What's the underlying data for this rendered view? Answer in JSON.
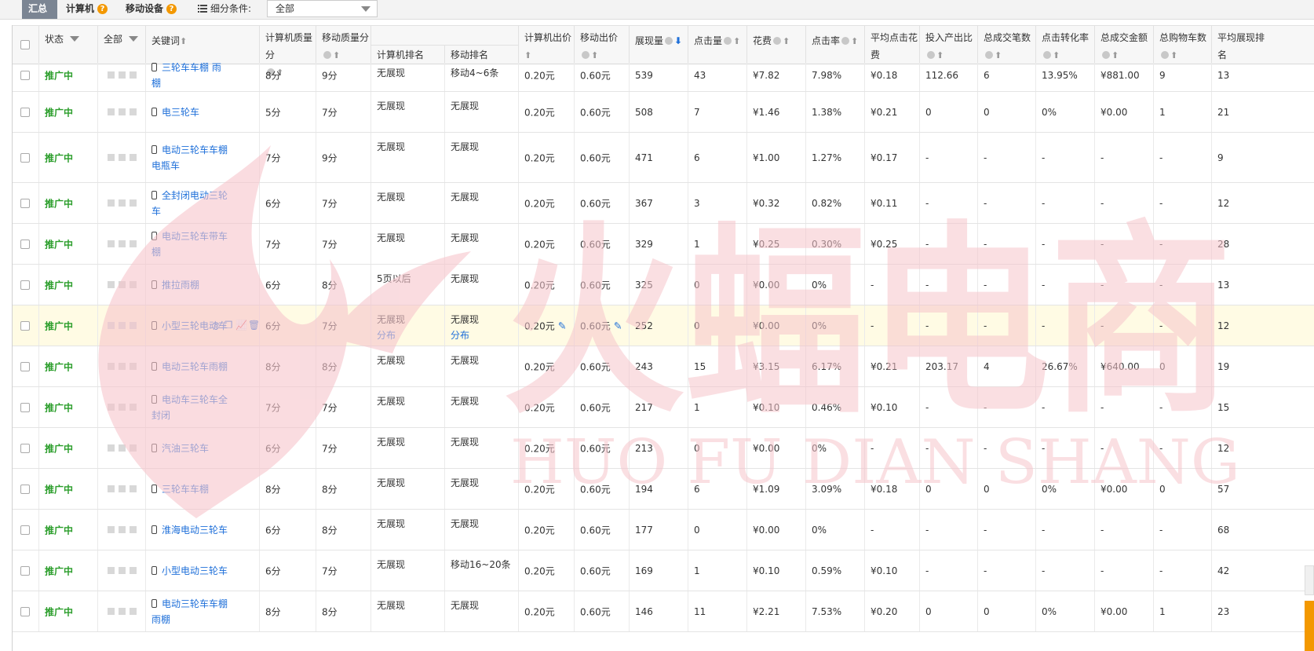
{
  "toolbar": {
    "tabs": [
      {
        "label": "汇总",
        "active": true,
        "has_help": false
      },
      {
        "label": "计算机",
        "active": false,
        "has_help": true
      },
      {
        "label": "移动设备",
        "active": false,
        "has_help": true
      }
    ],
    "help_glyph": "?",
    "filter_label": "细分条件:",
    "filter_value": "全部"
  },
  "header": {
    "status": "状态",
    "all": "全部",
    "keyword": "关键词",
    "pc_quality": "计算机质量分",
    "mobile_quality": "移动质量分",
    "pc_rank": "计算机排名",
    "mobile_rank": "移动排名",
    "pc_bid": "计算机出价",
    "mobile_bid": "移动出价",
    "impressions": "展现量",
    "clicks": "点击量",
    "cost": "花费",
    "ctr": "点击率",
    "avg_cpc": "平均点击花费",
    "roi": "投入产出比",
    "orders": "总成交笔数",
    "cvr": "点击转化率",
    "gmv": "总成交金额",
    "carts": "总购物车数",
    "avg_rank": "平均展现排名"
  },
  "rows": [
    {
      "status": "推广中",
      "keyword": "三轮车车棚 雨棚",
      "pc_q": "8分",
      "mob_q": "9分",
      "pc_rank": "无展现",
      "mob_rank": "移动4~6条",
      "pc_bid": "0.20元",
      "mob_bid": "0.60元",
      "imp": "539",
      "clk": "43",
      "cost": "¥7.82",
      "ctr": "7.98%",
      "cpc": "¥0.18",
      "roi": "112.66",
      "orders": "6",
      "cvr": "13.95%",
      "gmv": "¥881.00",
      "carts": "9",
      "rank": "13"
    },
    {
      "status": "推广中",
      "keyword": "电三轮车",
      "pc_q": "5分",
      "mob_q": "7分",
      "pc_rank": "无展现",
      "mob_rank": "无展现",
      "pc_bid": "0.20元",
      "mob_bid": "0.60元",
      "imp": "508",
      "clk": "7",
      "cost": "¥1.46",
      "ctr": "1.38%",
      "cpc": "¥0.21",
      "roi": "0",
      "orders": "0",
      "cvr": "0%",
      "gmv": "¥0.00",
      "carts": "1",
      "rank": "21"
    },
    {
      "status": "推广中",
      "keyword": "电动三轮车车棚 电瓶车",
      "pc_q": "7分",
      "mob_q": "9分",
      "pc_rank": "无展现",
      "mob_rank": "无展现",
      "pc_bid": "0.20元",
      "mob_bid": "0.60元",
      "imp": "471",
      "clk": "6",
      "cost": "¥1.00",
      "ctr": "1.27%",
      "cpc": "¥0.17",
      "roi": "-",
      "orders": "-",
      "cvr": "-",
      "gmv": "-",
      "carts": "-",
      "rank": "9"
    },
    {
      "status": "推广中",
      "keyword": "全封闭电动三轮车",
      "pc_q": "6分",
      "mob_q": "7分",
      "pc_rank": "无展现",
      "mob_rank": "无展现",
      "pc_bid": "0.20元",
      "mob_bid": "0.60元",
      "imp": "367",
      "clk": "3",
      "cost": "¥0.32",
      "ctr": "0.82%",
      "cpc": "¥0.11",
      "roi": "-",
      "orders": "-",
      "cvr": "-",
      "gmv": "-",
      "carts": "-",
      "rank": "12"
    },
    {
      "status": "推广中",
      "keyword": "电动三轮车带车棚",
      "pc_q": "7分",
      "mob_q": "7分",
      "pc_rank": "无展现",
      "mob_rank": "无展现",
      "pc_bid": "0.20元",
      "mob_bid": "0.60元",
      "imp": "329",
      "clk": "1",
      "cost": "¥0.25",
      "ctr": "0.30%",
      "cpc": "¥0.25",
      "roi": "-",
      "orders": "-",
      "cvr": "-",
      "gmv": "-",
      "carts": "-",
      "rank": "28"
    },
    {
      "status": "推广中",
      "keyword": "推拉雨棚",
      "pc_q": "6分",
      "mob_q": "8分",
      "pc_rank": "5页以后",
      "mob_rank": "无展现",
      "pc_bid": "0.20元",
      "mob_bid": "0.60元",
      "imp": "325",
      "clk": "0",
      "cost": "¥0.00",
      "ctr": "0%",
      "cpc": "-",
      "roi": "-",
      "orders": "-",
      "cvr": "-",
      "gmv": "-",
      "carts": "-",
      "rank": "13"
    },
    {
      "status": "推广中",
      "keyword": "小型三轮电动车",
      "pc_q": "6分",
      "mob_q": "7分",
      "pc_rank": "无展现",
      "mob_rank": "无展现",
      "pc_rank_link": "分布",
      "mob_rank_link": "分布",
      "pc_bid": "0.20元",
      "mob_bid": "0.60元",
      "imp": "252",
      "clk": "0",
      "cost": "¥0.00",
      "ctr": "0%",
      "cpc": "-",
      "roi": "-",
      "orders": "-",
      "cvr": "-",
      "gmv": "-",
      "carts": "-",
      "rank": "12",
      "highlight": true
    },
    {
      "status": "推广中",
      "keyword": "电动三轮车雨棚",
      "pc_q": "8分",
      "mob_q": "8分",
      "pc_rank": "无展现",
      "mob_rank": "无展现",
      "pc_bid": "0.20元",
      "mob_bid": "0.60元",
      "imp": "243",
      "clk": "15",
      "cost": "¥3.15",
      "ctr": "6.17%",
      "cpc": "¥0.21",
      "roi": "203.17",
      "orders": "4",
      "cvr": "26.67%",
      "gmv": "¥640.00",
      "carts": "0",
      "rank": "19"
    },
    {
      "status": "推广中",
      "keyword": "电动车三轮车全封闭",
      "pc_q": "7分",
      "mob_q": "7分",
      "pc_rank": "无展现",
      "mob_rank": "无展现",
      "pc_bid": "0.20元",
      "mob_bid": "0.60元",
      "imp": "217",
      "clk": "1",
      "cost": "¥0.10",
      "ctr": "0.46%",
      "cpc": "¥0.10",
      "roi": "-",
      "orders": "-",
      "cvr": "-",
      "gmv": "-",
      "carts": "-",
      "rank": "15"
    },
    {
      "status": "推广中",
      "keyword": "汽油三轮车",
      "pc_q": "6分",
      "mob_q": "7分",
      "pc_rank": "无展现",
      "mob_rank": "无展现",
      "pc_bid": "0.20元",
      "mob_bid": "0.60元",
      "imp": "213",
      "clk": "0",
      "cost": "¥0.00",
      "ctr": "0%",
      "cpc": "-",
      "roi": "-",
      "orders": "-",
      "cvr": "-",
      "gmv": "-",
      "carts": "-",
      "rank": "12"
    },
    {
      "status": "推广中",
      "keyword": "三轮车车棚",
      "pc_q": "8分",
      "mob_q": "8分",
      "pc_rank": "无展现",
      "mob_rank": "无展现",
      "pc_bid": "0.20元",
      "mob_bid": "0.60元",
      "imp": "194",
      "clk": "6",
      "cost": "¥1.09",
      "ctr": "3.09%",
      "cpc": "¥0.18",
      "roi": "0",
      "orders": "0",
      "cvr": "0%",
      "gmv": "¥0.00",
      "carts": "0",
      "rank": "57"
    },
    {
      "status": "推广中",
      "keyword": "淮海电动三轮车",
      "pc_q": "6分",
      "mob_q": "8分",
      "pc_rank": "无展现",
      "mob_rank": "无展现",
      "pc_bid": "0.20元",
      "mob_bid": "0.60元",
      "imp": "177",
      "clk": "0",
      "cost": "¥0.00",
      "ctr": "0%",
      "cpc": "-",
      "roi": "-",
      "orders": "-",
      "cvr": "-",
      "gmv": "-",
      "carts": "-",
      "rank": "68"
    },
    {
      "status": "推广中",
      "keyword": "小型电动三轮车",
      "pc_q": "6分",
      "mob_q": "7分",
      "pc_rank": "无展现",
      "mob_rank": "移动16~20条",
      "pc_bid": "0.20元",
      "mob_bid": "0.60元",
      "imp": "169",
      "clk": "1",
      "cost": "¥0.10",
      "ctr": "0.59%",
      "cpc": "¥0.10",
      "roi": "-",
      "orders": "-",
      "cvr": "-",
      "gmv": "-",
      "carts": "-",
      "rank": "42"
    },
    {
      "status": "推广中",
      "keyword": "电动三轮车车棚雨棚",
      "pc_q": "8分",
      "mob_q": "8分",
      "pc_rank": "无展现",
      "mob_rank": "无展现",
      "pc_bid": "0.20元",
      "mob_bid": "0.60元",
      "imp": "146",
      "clk": "11",
      "cost": "¥2.21",
      "ctr": "7.53%",
      "cpc": "¥0.20",
      "roi": "0",
      "orders": "0",
      "cvr": "0%",
      "gmv": "¥0.00",
      "carts": "1",
      "rank": "23"
    }
  ],
  "watermark": {
    "logo_text": "火蝠电商",
    "sub_text": "HUO FU DIAN SHANG",
    "color": "#f6c5cc"
  }
}
